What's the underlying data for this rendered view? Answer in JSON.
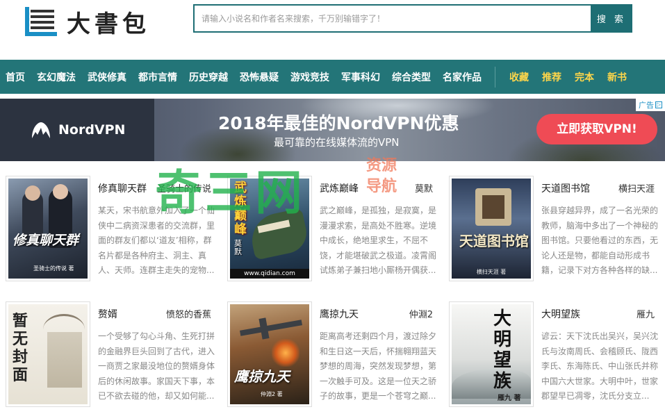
{
  "site": {
    "logo_text": "大書包"
  },
  "search": {
    "placeholder": "请输入小说名和作者名来搜索，千万别输错字了！",
    "button_label": "搜 索"
  },
  "nav": {
    "items": [
      "首页",
      "玄幻魔法",
      "武侠修真",
      "都市言情",
      "历史穿越",
      "恐怖悬疑",
      "游戏竞技",
      "军事科幻",
      "综合类型",
      "名家作品"
    ],
    "highlight_items": [
      "收藏",
      "推荐",
      "完本",
      "新书"
    ]
  },
  "ad": {
    "brand": "NordVPN",
    "headline": "2018年最佳的NordVPN优惠",
    "subline": "最可靠的在线媒体流的VPN",
    "cta": "立即获取VPN!",
    "tag": "广告"
  },
  "watermark": {
    "big": "奇三网",
    "small_line1": "资源",
    "small_line2": "导航"
  },
  "books": [
    {
      "title": "修真聊天群",
      "author": "圣骑士的传说",
      "desc": "某天，宋书航意外加入了一个仙侠中二病资深患者的交流群，里面的群友们都以‘道友’相称，群名片都是各种府主、洞主、真人、天师。连群主走失的宠物...",
      "cover_text": "修真聊天群",
      "cover_author": "圣骑士的传说 著"
    },
    {
      "title": "武炼巅峰",
      "author": "莫默",
      "desc": "武之巅峰，是孤独，是寂寞，是漫漫求索，是高处不胜寒。逆境中成长，绝地里求生，不屈不饶，才能堪破武之极道。凌霄阁试炼弟子兼扫地小厮杨开偶获...",
      "cover_text": "武炼巅峰",
      "cover_author": "莫默",
      "cover_site": "www.qidian.com"
    },
    {
      "title": "天道图书馆",
      "author": "横扫天涯",
      "desc": "张县穿越异界，成了一名光荣的教师，脑海中多出了一个神秘的图书馆。只要他看过的东西，无论人还是物，都能自动形成书籍，记录下对方各种各样的缺...",
      "cover_text": "天道图书馆",
      "cover_author": "横扫天涯 著"
    },
    {
      "title": "赘婿",
      "author": "愤怒的香蕉",
      "desc": "一个受够了勾心斗角、生死打拼的金融界巨头回到了古代，进入一商贾之家最没地位的赘婿身体后的休闲故事。家国天下事，本已不欲去碰的他，却又如何能...",
      "cover_text": "暂无封面"
    },
    {
      "title": "鹰掠九天",
      "author": "仲淵2",
      "desc": "距离高考还剩四个月，渡过除夕和生日这一天后，怀揣翱翔蓝天梦想的周海，突然发现梦想，第一次触手可及。这是一位天之骄子的故事，更是一个苍穹之巅...",
      "cover_text": "鹰掠九天",
      "cover_author": "仲淵2 著"
    },
    {
      "title": "大明望族",
      "author": "雁九",
      "desc": "谚云：天下沈氏出吴兴，吴兴沈氏与汝南周氏、会稽顾氏、陇西李氏、东海陈氏、中山张氏并称中国六大世家。大明中叶，世家郡望早已凋零，沈氏分支立...",
      "cover_text": "大明望族",
      "cover_author": "雁九 著"
    }
  ],
  "colors": {
    "nav_bg": "#237578",
    "search_border": "#1e6e74",
    "highlight": "#ffd64a",
    "ad_cta": "#ef4b55"
  }
}
